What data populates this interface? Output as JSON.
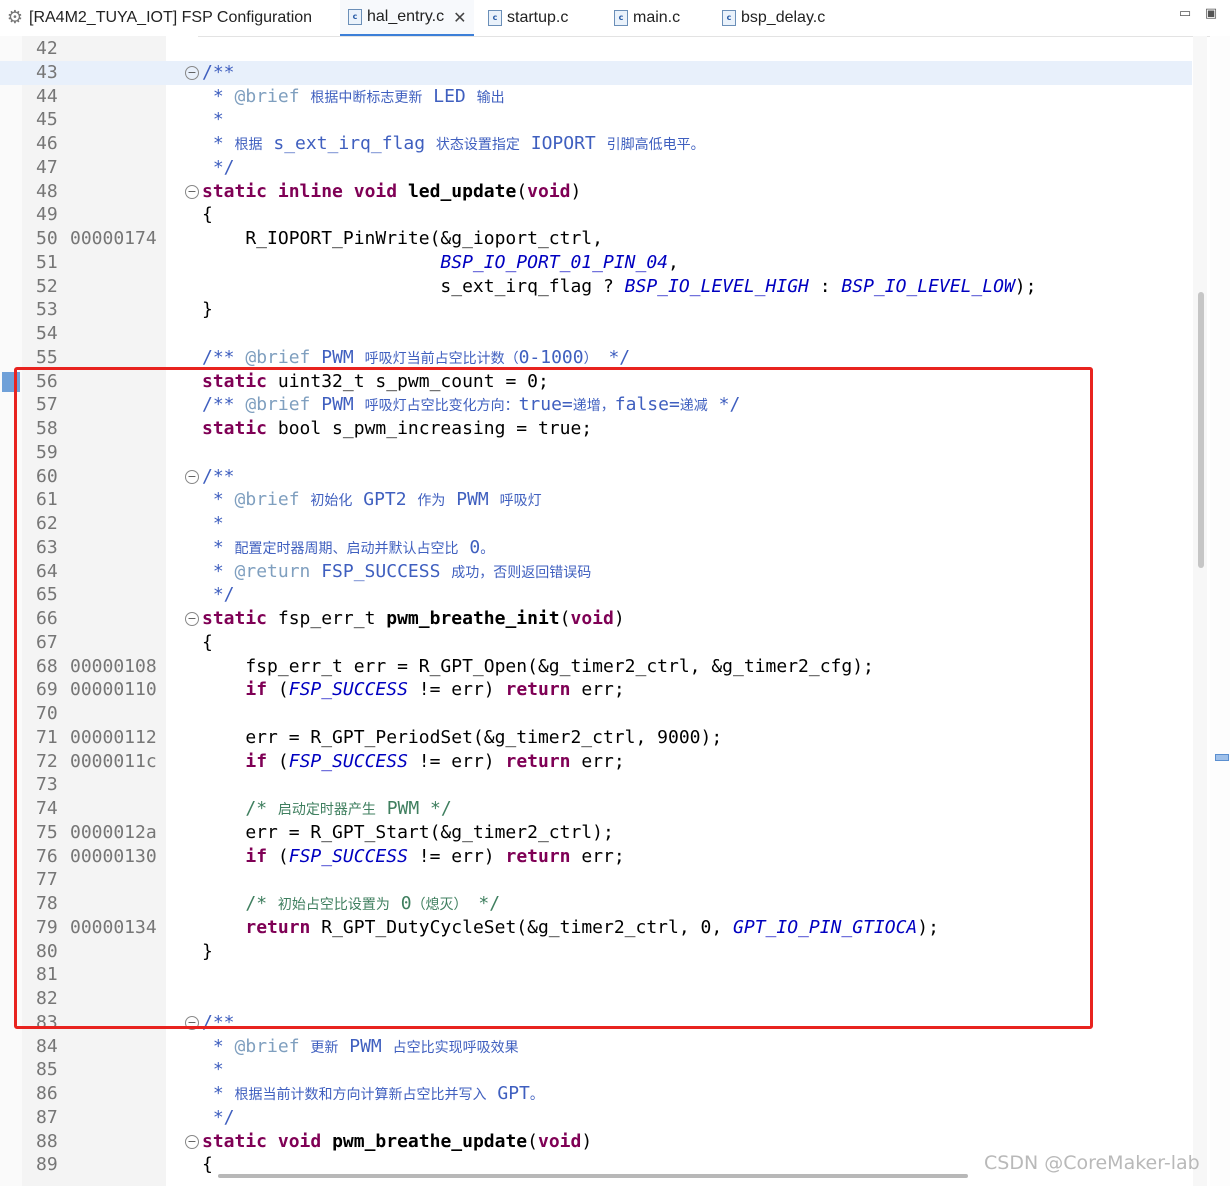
{
  "tabs": [
    {
      "label": "[RA4M2_TUYA_IOT] FSP Configuration",
      "icon": "gear-icon",
      "active": false
    },
    {
      "label": "hal_entry.c",
      "icon": "c-file-icon",
      "active": true
    },
    {
      "label": "startup.c",
      "icon": "c-file-icon",
      "active": false
    },
    {
      "label": "main.c",
      "icon": "c-file-icon",
      "active": false
    },
    {
      "label": "bsp_delay.c",
      "icon": "c-file-icon",
      "active": false
    }
  ],
  "window_controls": [
    "minimize-icon",
    "maximize-icon"
  ],
  "editor": {
    "lines": [
      {
        "n": "42",
        "addr": "",
        "fold": false,
        "html": ""
      },
      {
        "n": "43",
        "addr": "",
        "fold": true,
        "hl": true,
        "html": "<span class=\"cm\">/**</span>"
      },
      {
        "n": "44",
        "addr": "",
        "fold": false,
        "html": "<span class=\"cm\"> * <span class=\"tag\">@brief</span> <span class=\"ts\">根据中断标志更新</span> LED <span class=\"ts\">输出</span></span>"
      },
      {
        "n": "45",
        "addr": "",
        "fold": false,
        "html": "<span class=\"cm\"> *</span>"
      },
      {
        "n": "46",
        "addr": "",
        "fold": false,
        "html": "<span class=\"cm\"> * <span class=\"ts\">根据</span> s_ext_irq_flag <span class=\"ts\">状态设置指定</span> IOPORT <span class=\"ts\">引脚高低电平。</span></span>"
      },
      {
        "n": "47",
        "addr": "",
        "fold": false,
        "html": "<span class=\"cm\"> */</span>"
      },
      {
        "n": "48",
        "addr": "",
        "fold": true,
        "html": "<span class=\"kw\">static</span> <span class=\"kw\">inline</span> <span class=\"kw\">void</span> <span class=\"fn\">led_update</span>(<span class=\"kw\">void</span>)"
      },
      {
        "n": "49",
        "addr": "",
        "fold": false,
        "html": "{"
      },
      {
        "n": "50",
        "addr": "00000174",
        "fold": false,
        "html": "    R_IOPORT_PinWrite(&amp;g_ioport_ctrl,"
      },
      {
        "n": "51",
        "addr": "",
        "fold": false,
        "html": "                      <span class=\"mac\">BSP_IO_PORT_01_PIN_04</span>,"
      },
      {
        "n": "52",
        "addr": "",
        "fold": false,
        "html": "                      s_ext_irq_flag ? <span class=\"mac\">BSP_IO_LEVEL_HIGH</span> : <span class=\"mac\">BSP_IO_LEVEL_LOW</span>);"
      },
      {
        "n": "53",
        "addr": "",
        "fold": false,
        "html": "}"
      },
      {
        "n": "54",
        "addr": "",
        "fold": false,
        "html": ""
      },
      {
        "n": "55",
        "addr": "",
        "fold": false,
        "html": "<span class=\"cm\">/** <span class=\"tag\">@brief</span> PWM <span class=\"ts\">呼吸灯当前占空比计数（</span>0-1000<span class=\"ts\">）</span> */</span>"
      },
      {
        "n": "56",
        "addr": "",
        "fold": false,
        "bookmark": true,
        "html": "<span class=\"kw\">static</span> uint32_t s_pwm_count = 0;"
      },
      {
        "n": "57",
        "addr": "",
        "fold": false,
        "html": "<span class=\"cm\">/** <span class=\"tag\">@brief</span> PWM <span class=\"ts\">呼吸灯占空比变化方向：</span>true=<span class=\"ts\">递增，</span>false=<span class=\"ts\">递减</span> */</span>"
      },
      {
        "n": "58",
        "addr": "",
        "fold": false,
        "html": "<span class=\"kw\">static</span> bool s_pwm_increasing = true;"
      },
      {
        "n": "59",
        "addr": "",
        "fold": false,
        "html": ""
      },
      {
        "n": "60",
        "addr": "",
        "fold": true,
        "html": "<span class=\"cm\">/**</span>"
      },
      {
        "n": "61",
        "addr": "",
        "fold": false,
        "html": "<span class=\"cm\"> * <span class=\"tag\">@brief</span> <span class=\"ts\">初始化</span> GPT2 <span class=\"ts\">作为</span> PWM <span class=\"ts\">呼吸灯</span></span>"
      },
      {
        "n": "62",
        "addr": "",
        "fold": false,
        "html": "<span class=\"cm\"> *</span>"
      },
      {
        "n": "63",
        "addr": "",
        "fold": false,
        "html": "<span class=\"cm\"> * <span class=\"ts\">配置定时器周期、启动并默认占空比</span> 0<span class=\"ts\">。</span></span>"
      },
      {
        "n": "64",
        "addr": "",
        "fold": false,
        "html": "<span class=\"cm\"> * <span class=\"tag\">@return</span> FSP_SUCCESS <span class=\"ts\">成功，否则返回错误码</span></span>"
      },
      {
        "n": "65",
        "addr": "",
        "fold": false,
        "html": "<span class=\"cm\"> */</span>"
      },
      {
        "n": "66",
        "addr": "",
        "fold": true,
        "html": "<span class=\"kw\">static</span> fsp_err_t <span class=\"fn\">pwm_breathe_init</span>(<span class=\"kw\">void</span>)"
      },
      {
        "n": "67",
        "addr": "",
        "fold": false,
        "html": "{"
      },
      {
        "n": "68",
        "addr": "00000108",
        "fold": false,
        "html": "    fsp_err_t err = R_GPT_Open(&amp;g_timer2_ctrl, &amp;g_timer2_cfg);"
      },
      {
        "n": "69",
        "addr": "00000110",
        "fold": false,
        "html": "    <span class=\"kw\">if</span> (<span class=\"mac\">FSP_SUCCESS</span> != err) <span class=\"kw\">return</span> err;"
      },
      {
        "n": "70",
        "addr": "",
        "fold": false,
        "html": ""
      },
      {
        "n": "71",
        "addr": "00000112",
        "fold": false,
        "html": "    err = R_GPT_PeriodSet(&amp;g_timer2_ctrl, 9000);"
      },
      {
        "n": "72",
        "addr": "0000011c",
        "fold": false,
        "html": "    <span class=\"kw\">if</span> (<span class=\"mac\">FSP_SUCCESS</span> != err) <span class=\"kw\">return</span> err;"
      },
      {
        "n": "73",
        "addr": "",
        "fold": false,
        "html": ""
      },
      {
        "n": "74",
        "addr": "",
        "fold": false,
        "html": "    <span class=\"cmt\">/* <span class=\"ts\">启动定时器产生</span> PWM */</span>"
      },
      {
        "n": "75",
        "addr": "0000012a",
        "fold": false,
        "html": "    err = R_GPT_Start(&amp;g_timer2_ctrl);"
      },
      {
        "n": "76",
        "addr": "00000130",
        "fold": false,
        "html": "    <span class=\"kw\">if</span> (<span class=\"mac\">FSP_SUCCESS</span> != err) <span class=\"kw\">return</span> err;"
      },
      {
        "n": "77",
        "addr": "",
        "fold": false,
        "html": ""
      },
      {
        "n": "78",
        "addr": "",
        "fold": false,
        "html": "    <span class=\"cmt\">/* <span class=\"ts\">初始占空比设置为</span> 0<span class=\"ts\">（熄灭）</span> */</span>"
      },
      {
        "n": "79",
        "addr": "00000134",
        "fold": false,
        "html": "    <span class=\"kw\">return</span> R_GPT_DutyCycleSet(&amp;g_timer2_ctrl, 0, <span class=\"mac\">GPT_IO_PIN_GTIOCA</span>);"
      },
      {
        "n": "80",
        "addr": "",
        "fold": false,
        "html": "}"
      },
      {
        "n": "81",
        "addr": "",
        "fold": false,
        "html": ""
      },
      {
        "n": "82",
        "addr": "",
        "fold": false,
        "html": ""
      },
      {
        "n": "83",
        "addr": "",
        "fold": true,
        "html": "<span class=\"cm\">/**</span>"
      },
      {
        "n": "84",
        "addr": "",
        "fold": false,
        "html": "<span class=\"cm\"> * <span class=\"tag\">@brief</span> <span class=\"ts\">更新</span> PWM <span class=\"ts\">占空比实现呼吸效果</span></span>"
      },
      {
        "n": "85",
        "addr": "",
        "fold": false,
        "html": "<span class=\"cm\"> *</span>"
      },
      {
        "n": "86",
        "addr": "",
        "fold": false,
        "html": "<span class=\"cm\"> * <span class=\"ts\">根据当前计数和方向计算新占空比并写入</span> GPT<span class=\"ts\">。</span></span>"
      },
      {
        "n": "87",
        "addr": "",
        "fold": false,
        "html": "<span class=\"cm\"> */</span>"
      },
      {
        "n": "88",
        "addr": "",
        "fold": true,
        "html": "<span class=\"kw\">static</span> <span class=\"kw\">void</span> <span class=\"fn\">pwm_breathe_update</span>(<span class=\"kw\">void</span>)"
      },
      {
        "n": "89",
        "addr": "",
        "fold": false,
        "html": "{"
      }
    ]
  },
  "watermark": "CSDN @CoreMaker-lab"
}
